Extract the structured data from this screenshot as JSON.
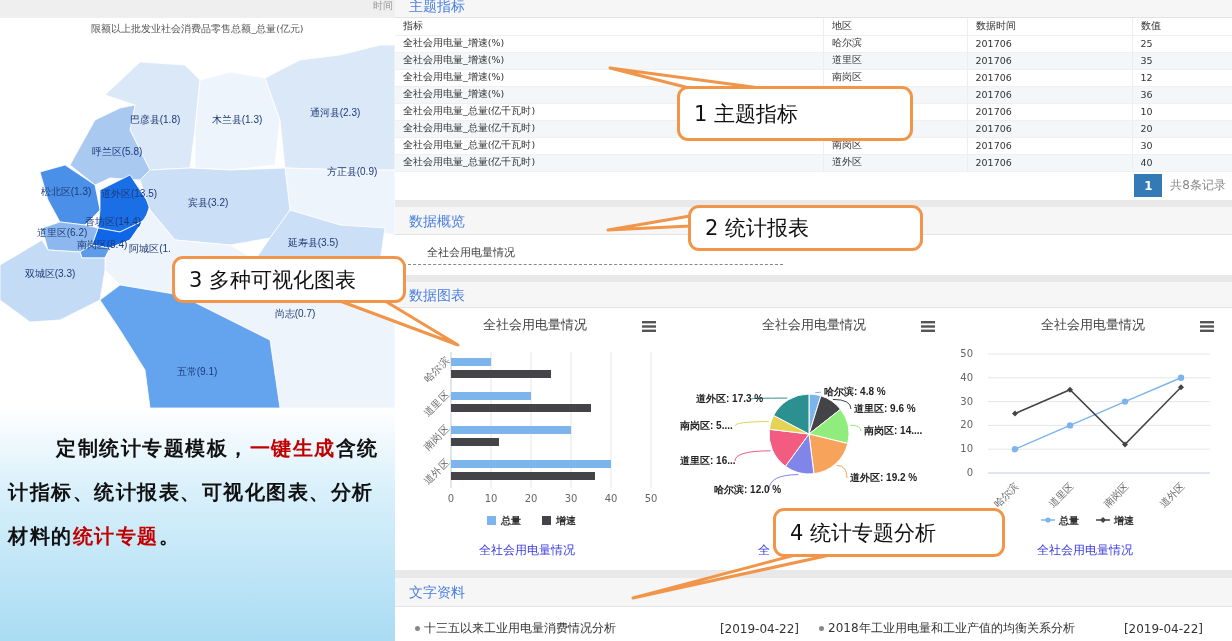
{
  "left": {
    "top_bar_text": "时间",
    "map": {
      "title": "限额以上批发业社会消费品零售总额_总量(亿元)",
      "regions": [
        {
          "label": "巴彦县(1.8)",
          "color": "#dbe8f8"
        },
        {
          "label": "木兰县(1.3)",
          "color": "#eef4fc"
        },
        {
          "label": "通河县(2.3)",
          "color": "#dbe8f8"
        },
        {
          "label": "呼兰区(5.8)",
          "color": "#a9c9f1"
        },
        {
          "label": "方正县(0.9)",
          "color": "#eef4fc"
        },
        {
          "label": "松北区(1.3)",
          "color": "#4a90e8"
        },
        {
          "label": "道外区(13.5)",
          "color": "#1a6fe6"
        },
        {
          "label": "宾县(3.2)",
          "color": "#cbdff6"
        },
        {
          "label": "香坊区(14.4)",
          "color": "#0f66e6"
        },
        {
          "label": "道里区(6.2)",
          "color": "#8cb8ef"
        },
        {
          "label": "南岗区(8.4)",
          "color": "#5d9ce9"
        },
        {
          "label": "延寿县(3.5)",
          "color": "#cbdff6"
        },
        {
          "label": "阿城区(1.",
          "color": "#eef4fc"
        },
        {
          "label": "双城区(3.3)",
          "color": "#c4dbf5"
        },
        {
          "label": "尚志(0.7)",
          "color": "#eef4fc"
        },
        {
          "label": "五常(9.1)",
          "color": "#64a3ee"
        }
      ]
    },
    "promo": [
      {
        "text": "定制统计专题模板，",
        "highlight": false
      },
      {
        "text": "一键生成",
        "highlight": true
      },
      {
        "text": "含统计指标、统计报表、可视化图表、分析材料的",
        "highlight": false
      },
      {
        "text": "统计专题",
        "highlight": true
      },
      {
        "text": "。",
        "highlight": false
      }
    ]
  },
  "indicators": {
    "title": "主题指标",
    "columns": [
      "指标",
      "地区",
      "数据时间",
      "数值"
    ],
    "rows": [
      {
        "indicator": "全社会用电量_增速(%)",
        "region": "哈尔滨",
        "period": "201706",
        "value": "25"
      },
      {
        "indicator": "全社会用电量_增速(%)",
        "region": "道里区",
        "period": "201706",
        "value": "35"
      },
      {
        "indicator": "全社会用电量_增速(%)",
        "region": "南岗区",
        "period": "201706",
        "value": "12"
      },
      {
        "indicator": "全社会用电量_增速(%)",
        "period": "201706",
        "value": "36"
      },
      {
        "indicator": "全社会用电量_总量(亿千瓦时)",
        "period": "201706",
        "value": "10"
      },
      {
        "indicator": "全社会用电量_总量(亿千瓦时)",
        "period": "201706",
        "value": "20"
      },
      {
        "indicator": "全社会用电量_总量(亿千瓦时)",
        "region": "南岗区",
        "period": "201706",
        "value": "30"
      },
      {
        "indicator": "全社会用电量_总量(亿千瓦时)",
        "region": "道外区",
        "period": "201706",
        "value": "40"
      }
    ],
    "pagination": {
      "pages": [
        {
          "label": "1",
          "selected": true
        }
      ],
      "total": "共8条记录"
    }
  },
  "overview": {
    "title": "数据概览",
    "items": [
      "全社会用电量情况"
    ]
  },
  "charts": {
    "title": "数据图表",
    "panels": [
      {
        "title": "全社会用电量情况",
        "link": "全社会用电量情况",
        "chart_data": {
          "type": "bar",
          "orientation": "horizontal",
          "categories": [
            "哈尔滨",
            "道里区",
            "南岗区",
            "道外区"
          ],
          "xticks": [
            0,
            10,
            20,
            30,
            40,
            50
          ],
          "xlim": [
            0,
            50
          ],
          "grid": true,
          "legend": true,
          "series": [
            {
              "name": "总量",
              "color": "#7cb5ec",
              "values": [
                10,
                20,
                30,
                40
              ]
            },
            {
              "name": "增速",
              "color": "#434348",
              "values": [
                25,
                35,
                12,
                36
              ]
            }
          ]
        }
      },
      {
        "title": "全社会用电量情况",
        "link": "全",
        "chart_data": {
          "type": "pie",
          "values": [
            4.8,
            9.6,
            14.4,
            19.2,
            12.0,
            16.8,
            5.8,
            17.3
          ],
          "colors": [
            "#7cb5ec",
            "#434348",
            "#90ed7d",
            "#f7a35c",
            "#8085e9",
            "#f15c80",
            "#e4d354",
            "#2b908f"
          ],
          "value_labels": [
            "哈尔滨: 4.8 %",
            "道里区: 9.6 %",
            "南岗区: 14....",
            "道外区: 19.2 %",
            "哈尔滨: 12.0 %",
            "道里区: 16...",
            "南岗区: 5....",
            "道外区: 17.3 %"
          ]
        }
      },
      {
        "title": "全社会用电量情况",
        "link": "全社会用电量情况",
        "chart_data": {
          "type": "line",
          "categories": [
            "哈尔滨",
            "道里区",
            "南岗区",
            "道外区"
          ],
          "yticks": [
            0,
            10,
            20,
            30,
            40,
            50
          ],
          "ylim": [
            0,
            50
          ],
          "grid": true,
          "legend": true,
          "series": [
            {
              "name": "总量",
              "color": "#7cb5ec",
              "values": [
                10,
                20,
                30,
                40
              ],
              "marker": "circle"
            },
            {
              "name": "增速",
              "color": "#434348",
              "values": [
                25,
                35,
                12,
                36
              ],
              "marker": "diamond"
            }
          ]
        }
      }
    ]
  },
  "documents": {
    "title": "文字资料",
    "items": [
      {
        "title": "十三五以来工业用电量消费情况分析",
        "date": "[2019-04-22]"
      },
      {
        "title": "2018年工业用电量和工业产值的均衡关系分析",
        "date": "[2019-04-22]"
      }
    ]
  },
  "callouts": [
    "1 主题指标",
    "2 统计报表",
    "3 多种可视化图表",
    "4 统计专题分析"
  ]
}
